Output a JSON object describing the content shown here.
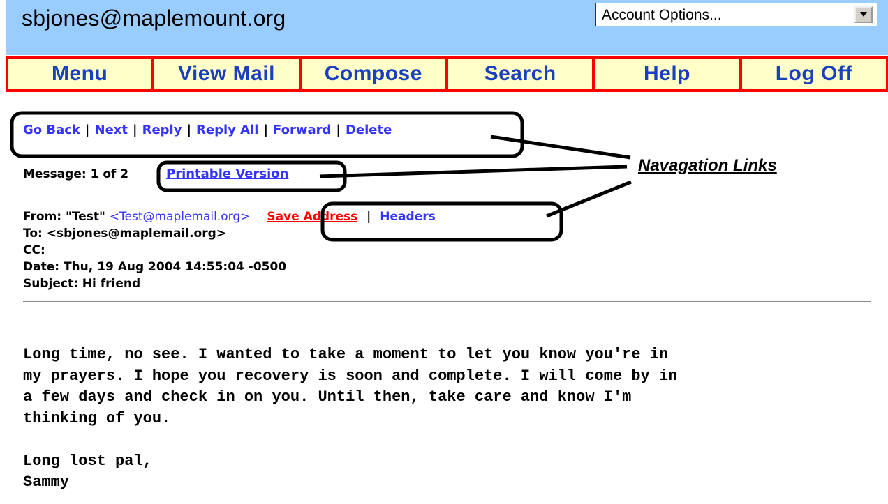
{
  "header": {
    "account": "sbjones@maplemount.org",
    "account_options": "Account Options..."
  },
  "nav": [
    "Menu",
    "View Mail",
    "Compose",
    "Search",
    "Help",
    "Log Off"
  ],
  "message_links": {
    "go_back": "Go Back",
    "next": "Next",
    "reply": "Reply",
    "reply_all": "Reply All",
    "forward": "Forward",
    "delete": "Delete"
  },
  "message": {
    "counter": "Message: 1 of 2",
    "printable": "Printable Version",
    "from_label": "From: \"Test\"",
    "from_email": "<Test@maplemail.org>",
    "save_address": "Save Address",
    "headers": "Headers",
    "to": "To: <sbjones@maplemail.org>",
    "cc": "CC:",
    "date": "Date: Thu, 19 Aug 2004 14:55:04 -0500",
    "subject": "Subject: Hi friend",
    "body": "Long time, no see. I wanted to take a moment to let you know you're in\nmy prayers. I hope you recovery is soon and complete. I will come by in\na few days and check in on you. Until then, take care and know I'm\nthinking of you.\n\nLong lost pal,\nSammy"
  },
  "annotation": "Navagation Links"
}
